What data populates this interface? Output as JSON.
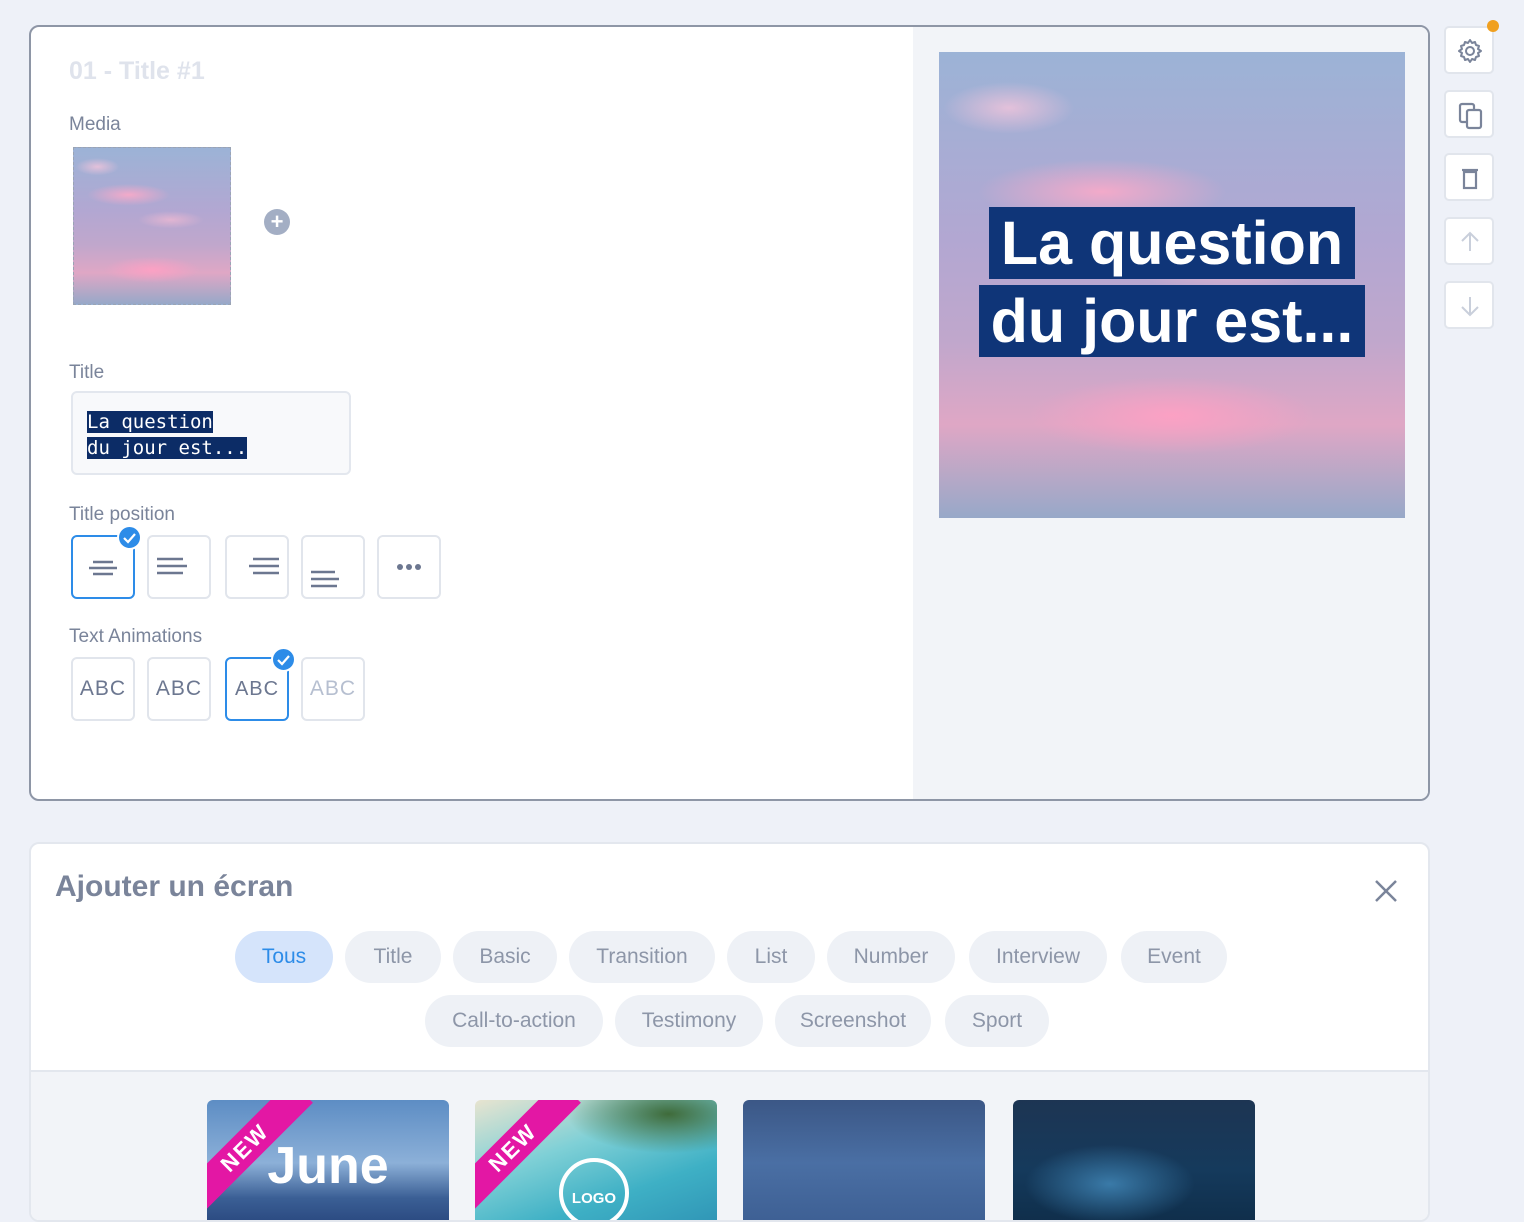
{
  "editor": {
    "screen_title": "01 - Title #1",
    "media_label": "Media",
    "add_media_icon": "plus-icon",
    "title_label": "Title",
    "title_value_line1": "La question",
    "title_value_line2": "du jour est...",
    "title_position_label": "Title position",
    "title_positions": [
      "center",
      "left",
      "right",
      "bottom-left",
      "more"
    ],
    "title_position_selected": "center",
    "text_animations_label": "Text Animations",
    "text_animations": [
      "ABC",
      "ABC",
      "ABC",
      "ABC"
    ],
    "text_animation_selected": 2
  },
  "preview": {
    "caption_line1": "La question",
    "caption_line2": "du jour est..."
  },
  "toolbar": {
    "icons": [
      "gear-icon",
      "copy-icon",
      "trash-icon",
      "arrow-up-icon",
      "arrow-down-icon"
    ],
    "notification_color": "#f0a020"
  },
  "add_screen": {
    "title": "Ajouter un écran",
    "categories": [
      "Tous",
      "Title",
      "Basic",
      "Transition",
      "List",
      "Number",
      "Interview",
      "Event",
      "Call-to-action",
      "Testimony",
      "Screenshot",
      "Sport"
    ],
    "active_category": "Tous",
    "templates": [
      {
        "badge": "NEW",
        "text": "June"
      },
      {
        "badge": "NEW",
        "text": "LOGO"
      },
      {
        "badge": "",
        "text": ""
      },
      {
        "badge": "",
        "text": ""
      }
    ]
  },
  "colors": {
    "accent": "#2d8ce8",
    "badge": "#e317a4",
    "caption_bg": "#0f3578"
  }
}
